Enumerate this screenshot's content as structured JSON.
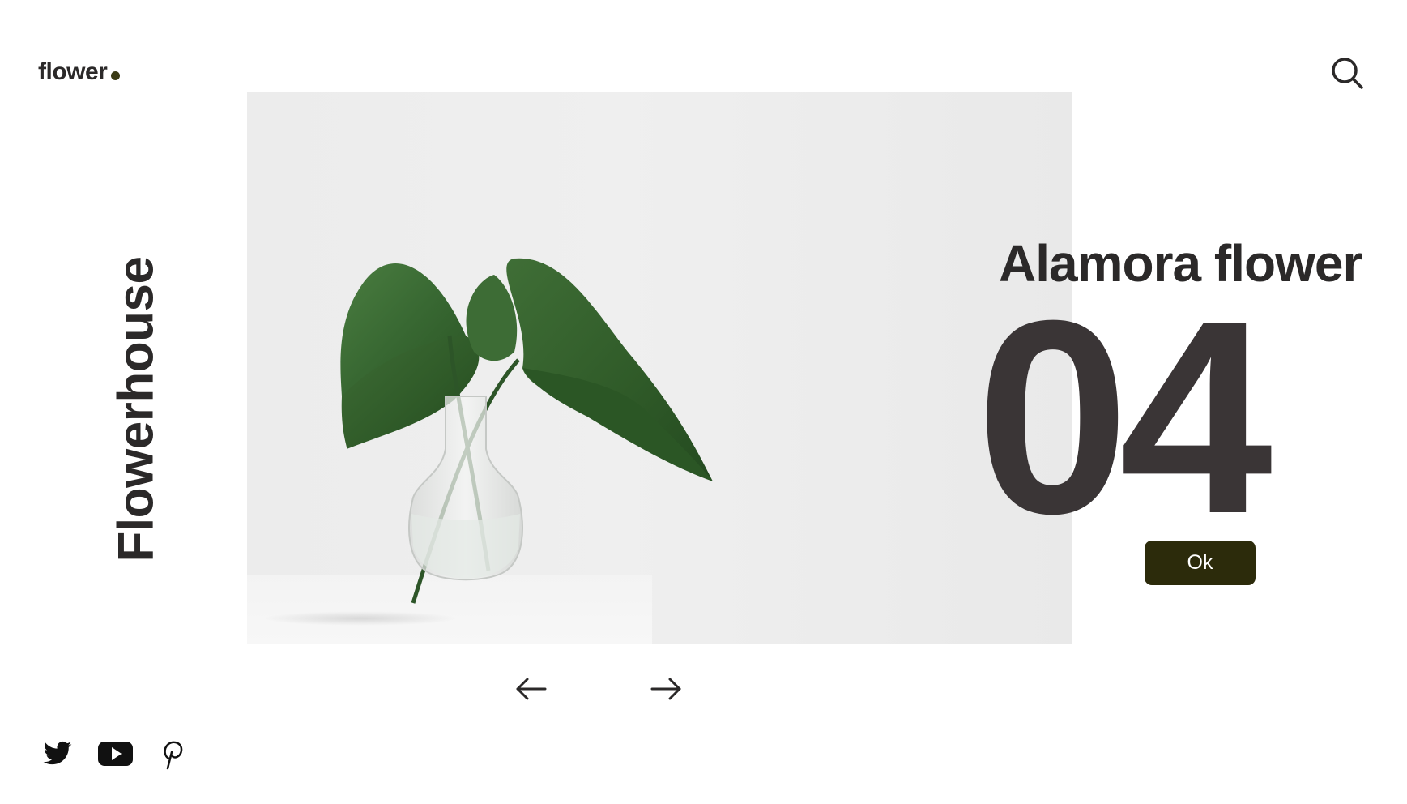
{
  "header": {
    "logo_text": "flower",
    "search_icon": "search-icon"
  },
  "sidebar": {
    "vertical_title": "Flowerhouse"
  },
  "hero": {
    "image": "plant-in-glass-vase"
  },
  "info": {
    "title": "Alamora flower",
    "number": "04",
    "ok_label": "Ok"
  },
  "navigation": {
    "prev_icon": "arrow-left-icon",
    "next_icon": "arrow-right-icon"
  },
  "social": {
    "items": [
      "twitter-icon",
      "youtube-icon",
      "pinterest-icon"
    ]
  },
  "colors": {
    "text": "#2b2929",
    "accent": "#2c2b0b",
    "number": "#3a3536",
    "hero_bg": "#ececec"
  }
}
